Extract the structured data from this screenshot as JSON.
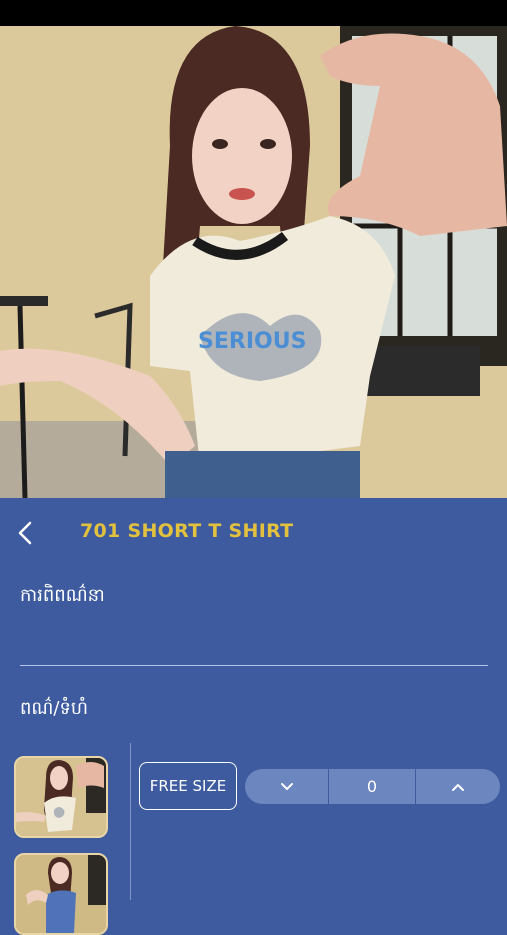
{
  "product": {
    "title": "701 SHORT T SHIRT",
    "shirt_print": "SERIOUS"
  },
  "sections": {
    "description_label": "ការពិពណ៌នា",
    "color_size_label": "ពណ៌/ទំហំ"
  },
  "variant": {
    "size_label": "FREE SIZE",
    "quantity": "0"
  },
  "icons": {
    "back": "chevron-left-icon",
    "decrease": "chevron-down-icon",
    "increase": "chevron-up-icon"
  },
  "colors": {
    "background": "#3d5b9e",
    "title": "#e2c13f",
    "stepper": "#6c86c0"
  }
}
